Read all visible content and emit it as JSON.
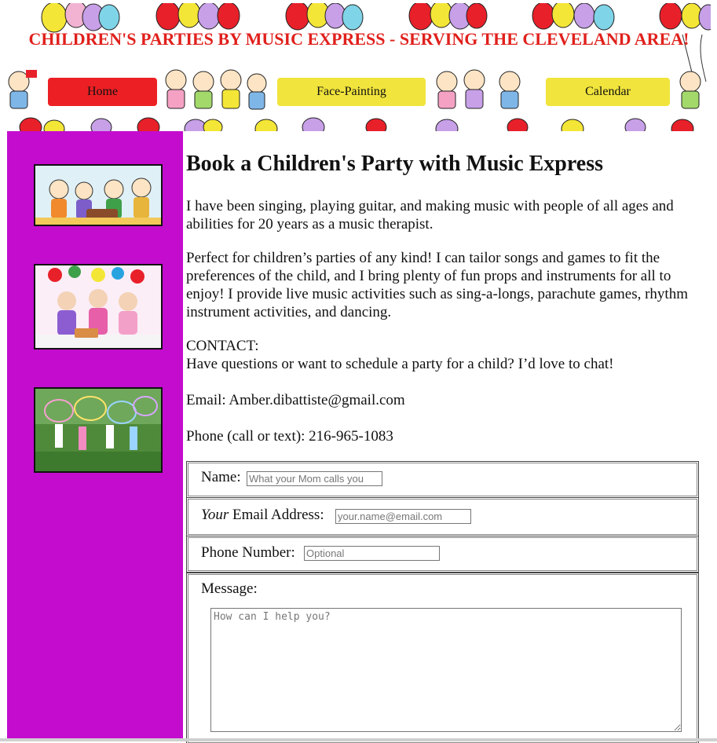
{
  "header": {
    "title": "CHILDREN'S PARTIES BY MUSIC EXPRESS - SERVING THE CLEVELAND AREA!",
    "nav": [
      {
        "label": "Home",
        "color": "#ec2024"
      },
      {
        "label": "Face-Painting",
        "color": "#f1e43c"
      },
      {
        "label": "Calendar",
        "color": "#f1e43c"
      }
    ]
  },
  "colors": {
    "title_red": "#e0201c",
    "sidebar_purple": "#c40ccf"
  },
  "main": {
    "title": "Book a Children's Party with Music Express",
    "intro": "I have been singing, playing guitar, and making music with people of all ages and abilities for 20 years as a music therapist.",
    "perfect": "Perfect for children’s parties of any kind! I can tailor songs and games to fit the preferences of the child, and I bring plenty of fun props and instruments for all to enjoy! I provide live music activities such as sing-a-longs, parachute games, rhythm instrument activities, and dancing.",
    "contact_heading": "CONTACT:",
    "contact_text": "Have questions or want to schedule a party for a child? I’d love to chat!",
    "email_line": "Email: Amber.dibattiste@gmail.com",
    "phone_line": "Phone (call or text): 216-965-1083"
  },
  "form": {
    "name_label": "Name:",
    "name_placeholder": "What your Mom calls you",
    "email_label_em": "Your",
    "email_label_rest": " Email Address:",
    "email_placeholder": "your.name@email.com",
    "phone_label": "Phone Number:",
    "phone_placeholder": "Optional",
    "message_label": "Message:",
    "message_placeholder": "How can I help you?"
  }
}
